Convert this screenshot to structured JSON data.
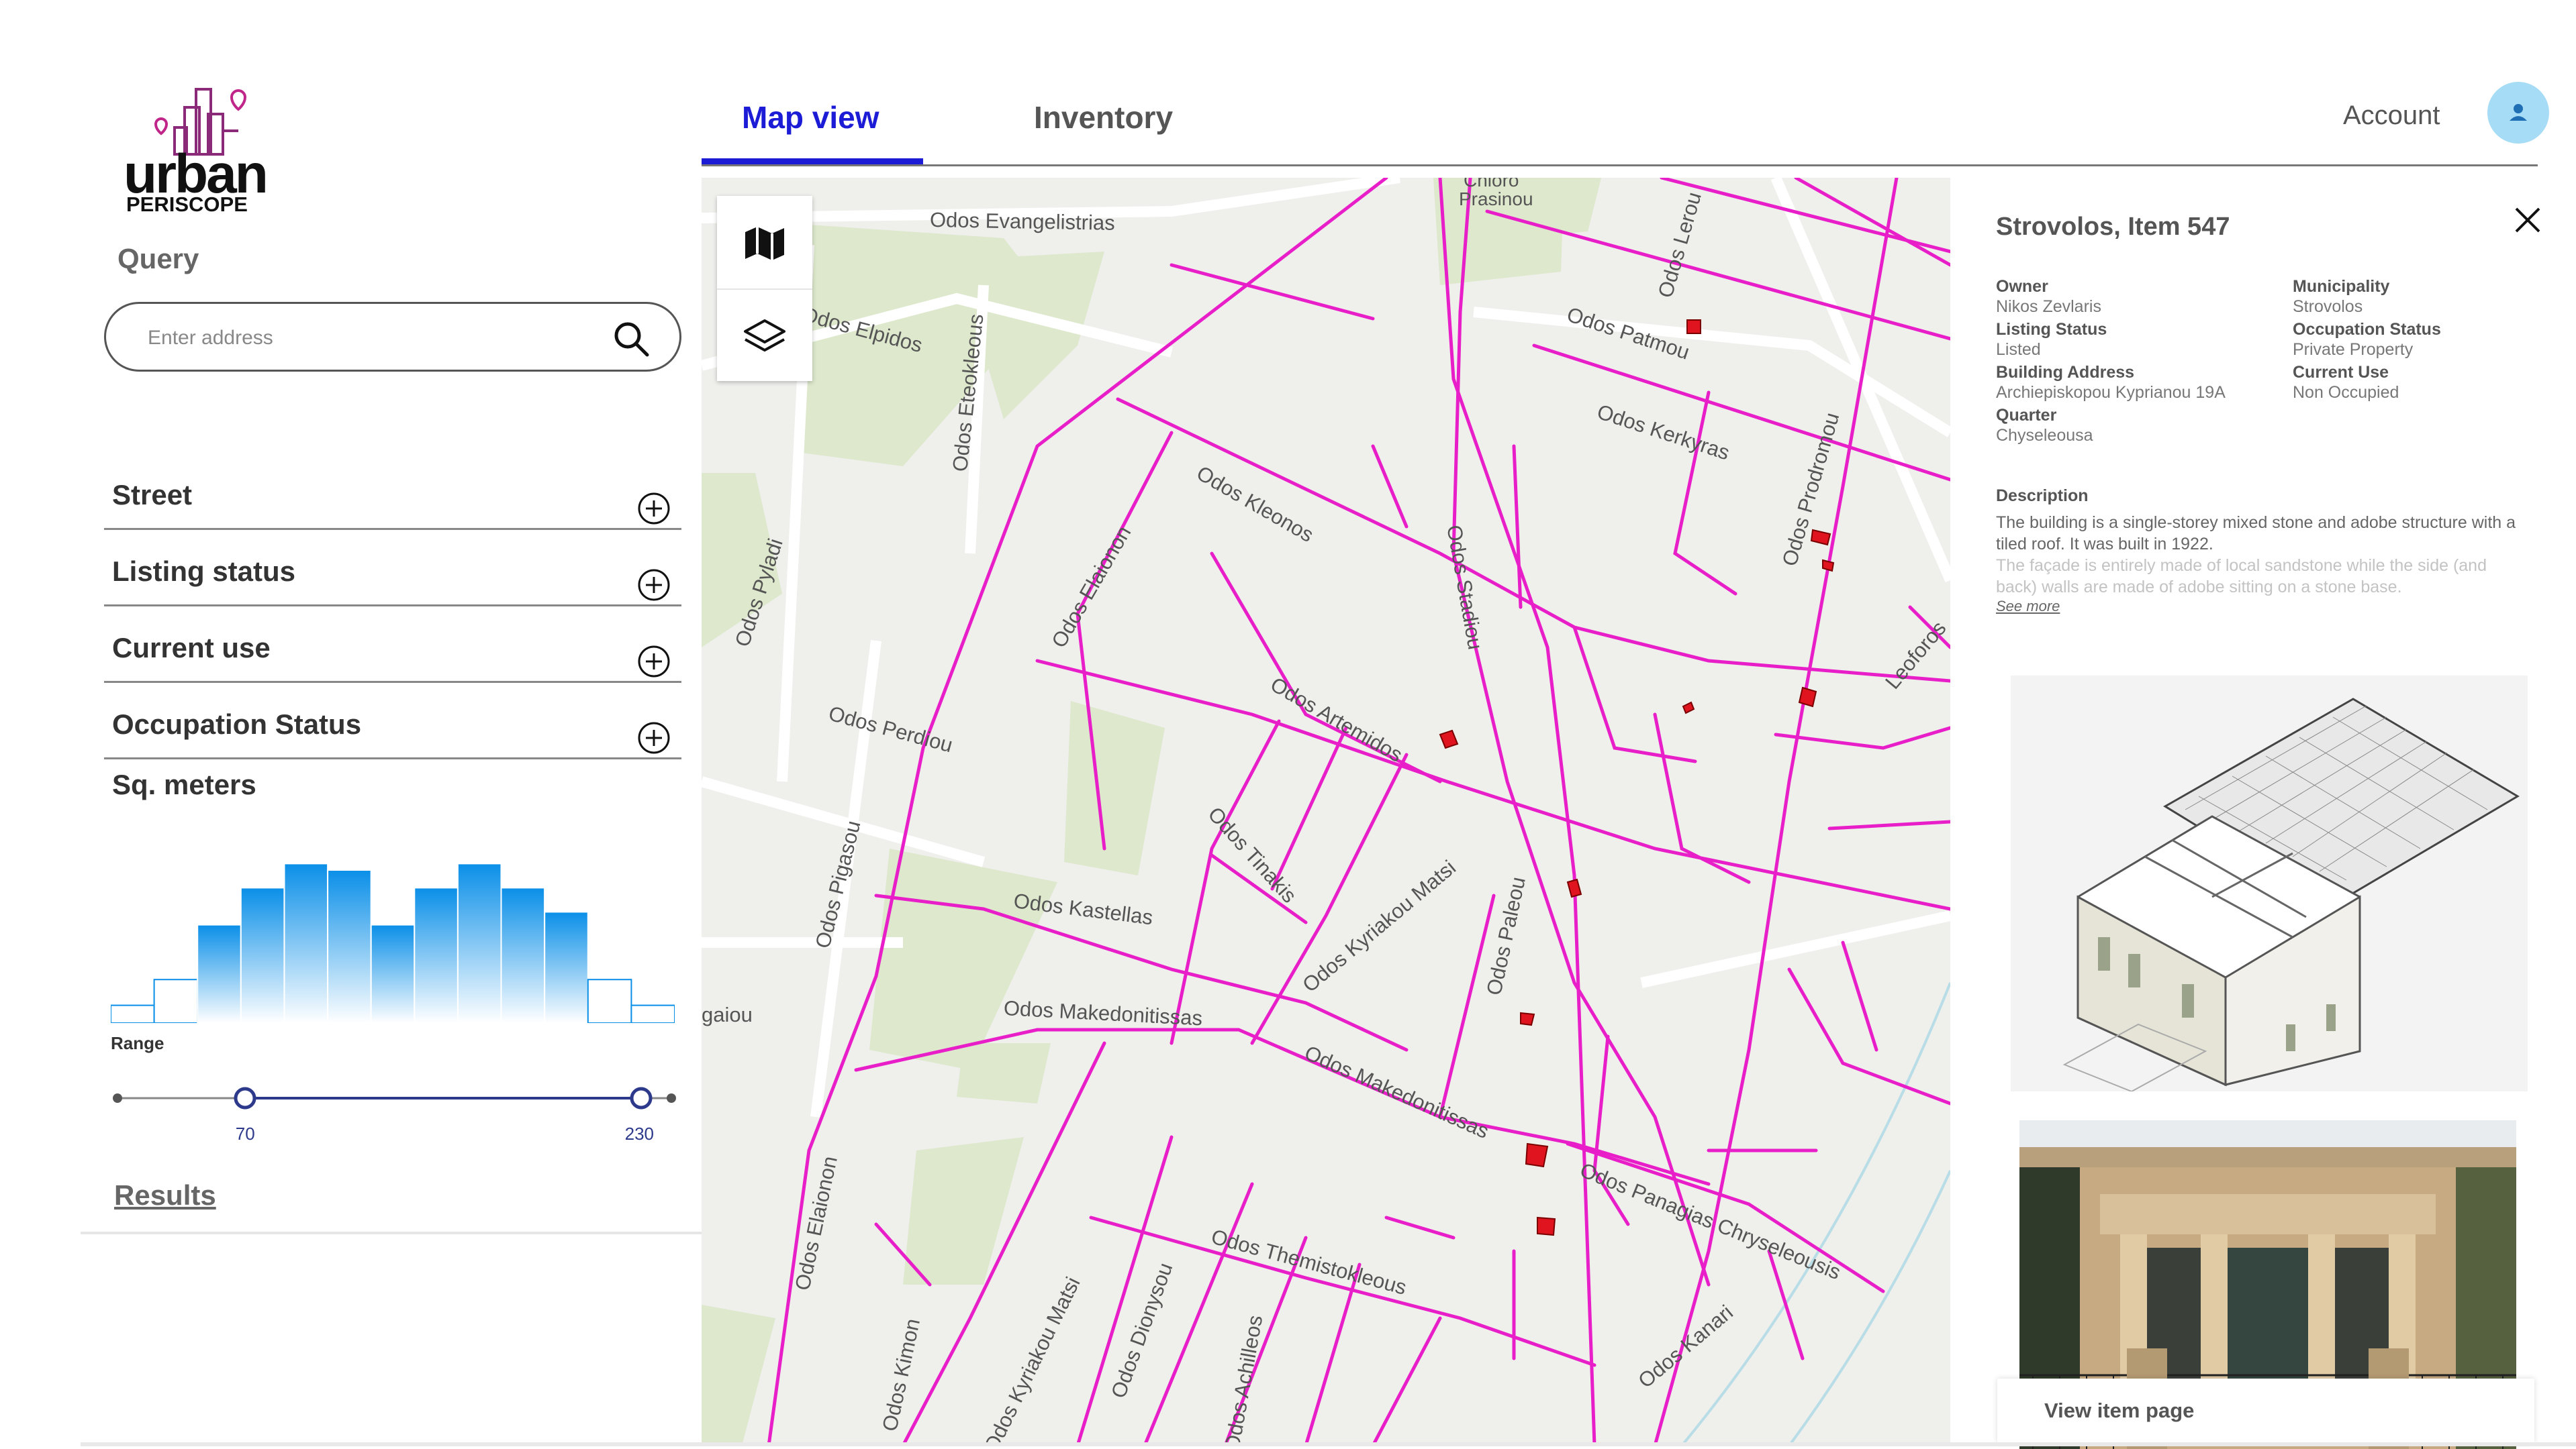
{
  "logo": {
    "word": "urban",
    "sub": "PERISCOPE"
  },
  "sidebar": {
    "query_title": "Query",
    "search_placeholder": "Enter address",
    "filters": [
      {
        "label": "Street"
      },
      {
        "label": "Listing status"
      },
      {
        "label": "Current use"
      },
      {
        "label": "Occupation Status"
      }
    ],
    "sqm_title": "Sq. meters",
    "histogram": {
      "heights": [
        0.11,
        0.27,
        0.61,
        0.84,
        0.99,
        0.95,
        0.61,
        0.84,
        0.99,
        0.84,
        0.69,
        0.27,
        0.11
      ],
      "selected_from": 2,
      "selected_to": 10,
      "color_top": "#0a8fe8",
      "color_bottom": "#ffffff"
    },
    "range_label": "Range",
    "range": {
      "min_label": "70",
      "max_label": "230",
      "low_fraction": 0.23,
      "high_fraction": 0.945
    },
    "results_label": "Results"
  },
  "header": {
    "tabs": [
      {
        "label": "Map view",
        "active": true
      },
      {
        "label": "Inventory",
        "active": false
      }
    ],
    "account_label": "Account",
    "accent_color": "#1c1cd6"
  },
  "map": {
    "road_color": "#e81ec8",
    "labels": {
      "evangelistrias": "Odos Evangelistrias",
      "elpidos": "Odos Elpidos",
      "eteokleous": "Odos Eteokleous",
      "prasinou_a": "Chloro",
      "prasinou_b": "Prasinou",
      "patmou": "Odos Patmou",
      "lerou": "Odos Lerou",
      "kerkyras": "Odos Kerkyras",
      "kleonos": "Odos Kleonos",
      "elaionon": "Odos Elaionon",
      "pyladi": "Odos Pyladi",
      "stadiou": "Odos Stadiou",
      "prodromou": "Odos Prodromou",
      "leoforos": "Leoforos",
      "perdiou": "Odos Perdiou",
      "artemidos": "Odos Artemidos",
      "tinakis": "Odos Tinakis",
      "pigasou": "Odos Pigasou",
      "kastellas": "Odos Kastellas",
      "kyriakou": "Odos Kyriakou Matsi",
      "makedonitissas_a": "Odos Makedonitissas",
      "makedonitissas_b": "Odos Makedonitissas",
      "gaiou": "gaiou",
      "paleou": "Odos Paleou",
      "elaionon_b": "Odos Elaionon",
      "panagias": "Odos Panagias Chryseleousis",
      "themistokleous": "Odos Themistokleous",
      "kimon": "Odos Kimon",
      "kyriakou_b": "Odos Kyriakou Matsi",
      "dionysou": "Odos Dionysou",
      "achilleos": "Odos Achilleos",
      "kanaris": "Odos Kanari"
    }
  },
  "panel": {
    "title": "Strovolos, Item 547",
    "fields_left": [
      {
        "label": "Owner",
        "value": "Nikos Zevlaris"
      },
      {
        "label": "Listing Status",
        "value": "Listed"
      },
      {
        "label": "Building Address",
        "value": "Archiepiskopou Kyprianou 19A"
      },
      {
        "label": "Quarter",
        "value": "Chyseleousa"
      }
    ],
    "fields_right": [
      {
        "label": "Municipality",
        "value": "Strovolos"
      },
      {
        "label": "Occupation Status",
        "value": "Private Property"
      },
      {
        "label": "Current Use",
        "value": "Non Occupied"
      }
    ],
    "description_title": "Description",
    "description": "The building is a single-storey mixed stone and adobe structure with a tiled roof. It was built in 1922.",
    "description_more": "The façade is entirely made of local sandstone while the side (and back) walls are made of adobe sitting on a stone base.",
    "see_more": "See more",
    "view_item_label": "View item page"
  }
}
